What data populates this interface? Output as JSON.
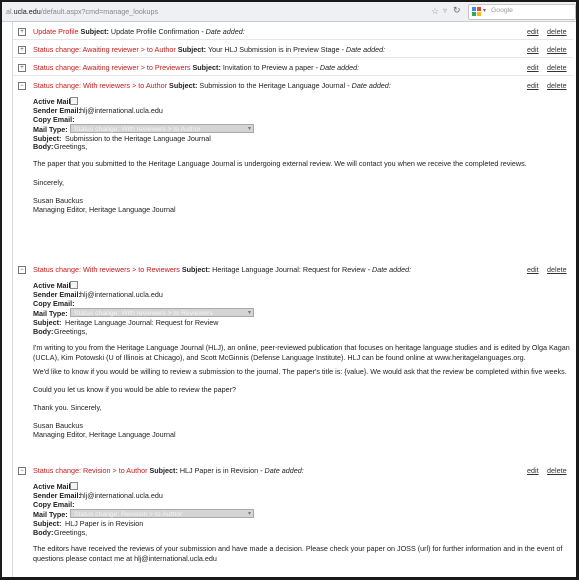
{
  "browser": {
    "url_prefix": "al.",
    "url_domain": "ucla.edu",
    "url_path": "/default.aspx?cmd=manage_lookups",
    "search_placeholder": "Google"
  },
  "labels": {
    "subject_bold": "Subject:",
    "date_added": "- Date added:",
    "edit": "edit",
    "delete": "delete",
    "active_mail": "Active Mail:",
    "sender_email": "Sender Email:",
    "copy_email": "Copy Email:",
    "mail_type": "Mail Type:",
    "subject": "Subject:",
    "body": "Body:"
  },
  "collapsed": [
    {
      "toggle": "+",
      "type": "Update Profile",
      "subject": "Update Profile Confirmation"
    },
    {
      "toggle": "+",
      "type": "Status change: Awaiting reviewer > to Author",
      "subject": "Your HLJ Submission is in Preview Stage"
    },
    {
      "toggle": "+",
      "type": "Status change: Awaiting reviewer > to Previewers",
      "subject": "Invitation to Preview a paper"
    }
  ],
  "e1": {
    "toggle": "−",
    "type": "Status change: With reviewers > to Author",
    "subject": "Submission to the Heritage Language Journal",
    "sender": "hlj@international.ucla.edu",
    "mail_type": "Status change: With reviewers > to Author",
    "subj_val": "Submission to the Heritage Language Journal",
    "greeting": "Greetings,",
    "para1": "The paper that you submitted to the Heritage Language Journal is undergoing external review. We will contact you when we receive the completed reviews.",
    "sincerely": "Sincerely,",
    "sig_name": "Susan Bauckus",
    "sig_title": "Managing Editor, Heritage Language Journal"
  },
  "e2": {
    "toggle": "−",
    "type": "Status change: With reviewers > to Reviewers",
    "subject": "Heritage Language Journal: Request for Review",
    "sender": "hlj@international.ucla.edu",
    "mail_type": "Status change: With reviewers > to Reviewers",
    "subj_val": "Heritage Language Journal: Request for Review",
    "greeting": "Greetings,",
    "para1": "I'm writing to you from the Heritage Language Journal (HLJ), an online, peer-reviewed publication that focuses on heritage language studies and is edited by Olga Kagan (UCLA), Kim Potowski (U of Illinois at Chicago), and Scott McGinnis (Defense Language Institute). HLJ can be found online at www.heritagelanguages.org.",
    "para2": "We'd like to know if you would be willing to review a submission to the journal. The paper's title is: {value}. We would ask that the review be completed within five weeks.",
    "para3": "Could you let us know if you would be able to review the paper?",
    "thanks": "Thank you. Sincerely,",
    "sig_name": "Susan Bauckus",
    "sig_title": "Managing Editor, Heritage Language Journal"
  },
  "e3": {
    "toggle": "−",
    "type": "Status change: Revision > to Author",
    "subject": "HLJ Paper is in Revision",
    "sender": "hlj@international.ucla.edu",
    "mail_type": "Status change: Revision > to Author",
    "subj_val": "HLJ Paper is in Revision",
    "greeting": "Greetings,",
    "para1": "The editors have received the reviews of your submission and have made a decision. Please check your paper on JOSS (url) for further information and in the event of questions please contact me at hlj@international.ucla.edu"
  },
  "colors": {
    "status_red": "#c41b1b",
    "link": "#333333"
  }
}
